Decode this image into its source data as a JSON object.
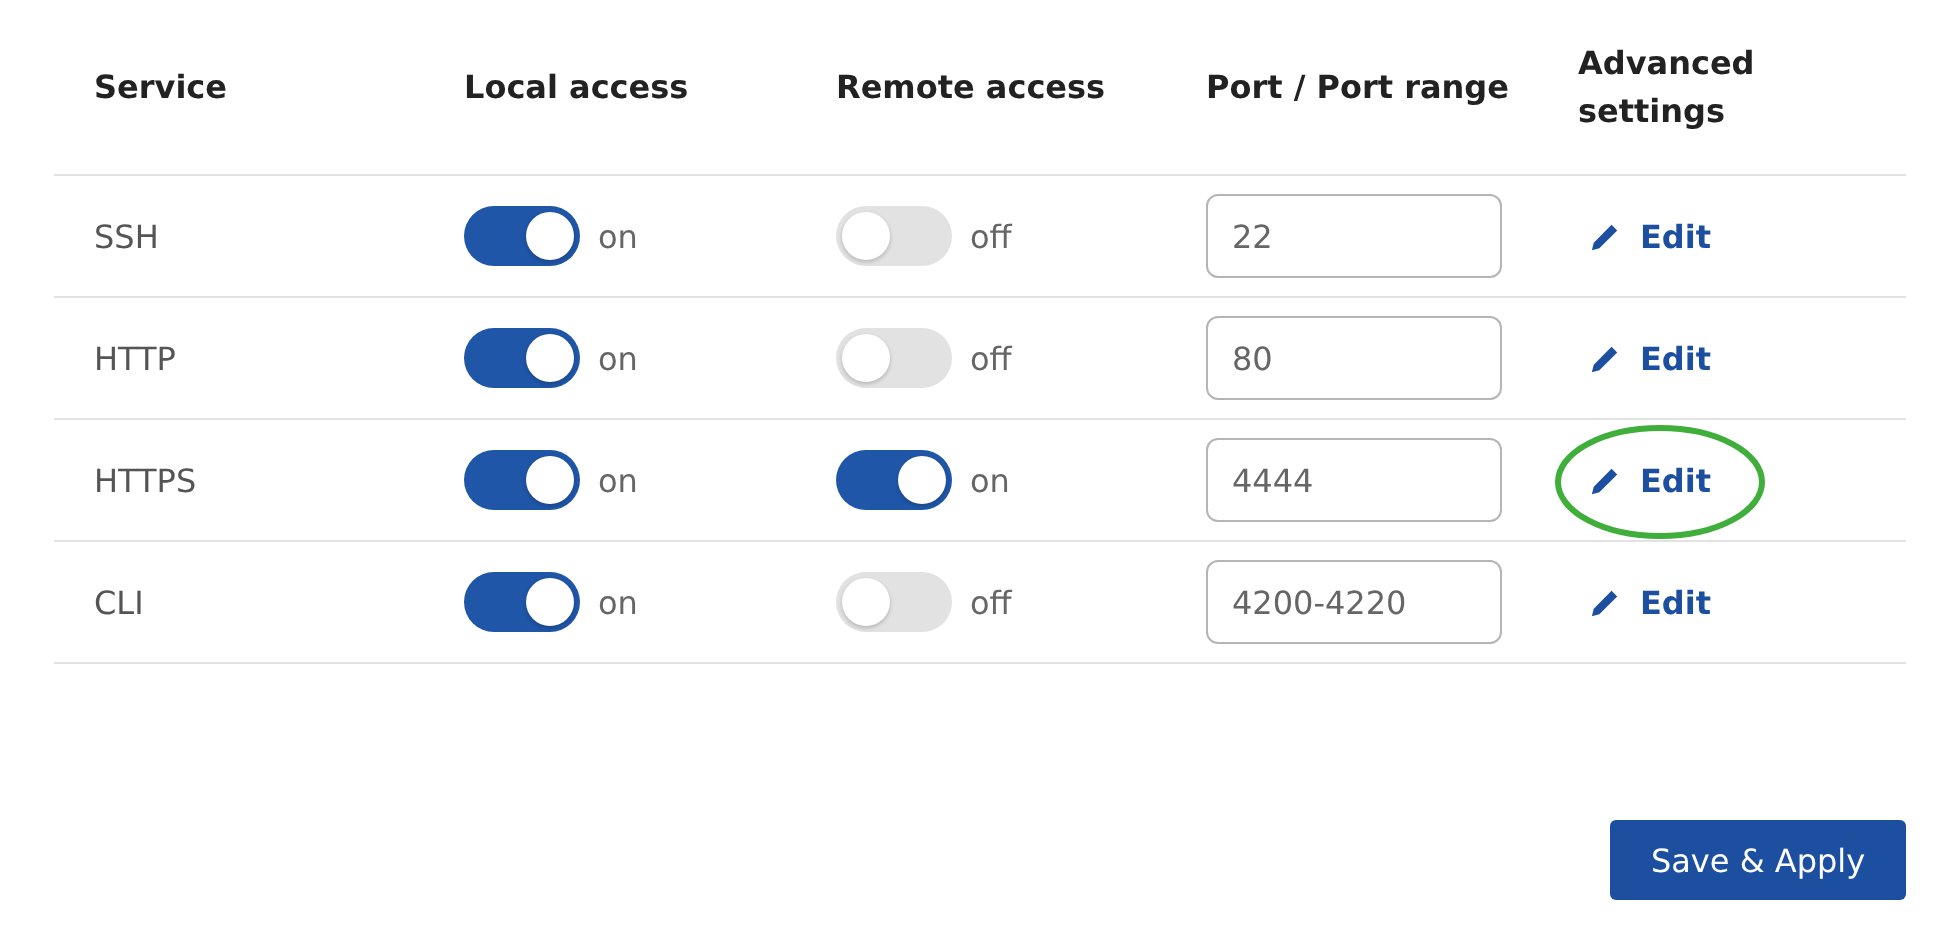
{
  "table": {
    "columns": [
      "Service",
      "Local access",
      "Remote access",
      "Port / Port range",
      "Advanced settings"
    ],
    "rows": [
      {
        "service": "SSH",
        "local": {
          "on": true,
          "label": "on"
        },
        "remote": {
          "on": false,
          "label": "off"
        },
        "port": "22",
        "action": "Edit",
        "highlighted": false
      },
      {
        "service": "HTTP",
        "local": {
          "on": true,
          "label": "on"
        },
        "remote": {
          "on": false,
          "label": "off"
        },
        "port": "80",
        "action": "Edit",
        "highlighted": false
      },
      {
        "service": "HTTPS",
        "local": {
          "on": true,
          "label": "on"
        },
        "remote": {
          "on": true,
          "label": "on"
        },
        "port": "4444",
        "action": "Edit",
        "highlighted": true
      },
      {
        "service": "CLI",
        "local": {
          "on": true,
          "label": "on"
        },
        "remote": {
          "on": false,
          "label": "off"
        },
        "port": "4200-4220",
        "action": "Edit",
        "highlighted": false
      }
    ]
  },
  "save_button": "Save & Apply"
}
